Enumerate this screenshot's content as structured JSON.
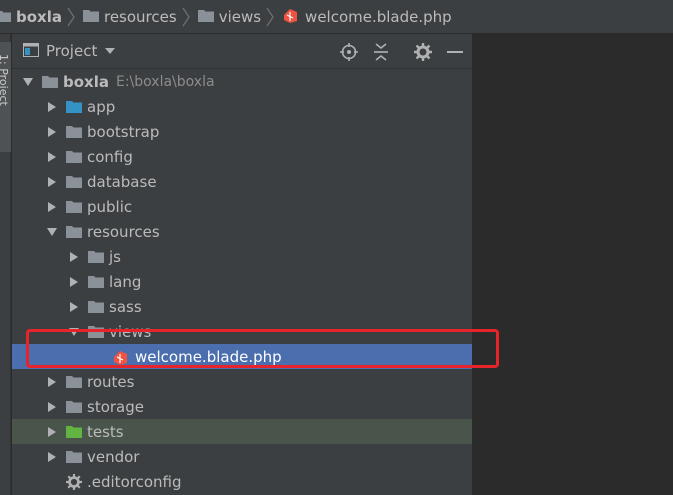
{
  "breadcrumb": {
    "items": [
      {
        "label": "boxla",
        "icon": "folder-icon",
        "bold": true
      },
      {
        "label": "resources",
        "icon": "folder-icon",
        "bold": false
      },
      {
        "label": "views",
        "icon": "folder-icon",
        "bold": false
      },
      {
        "label": "welcome.blade.php",
        "icon": "laravel-blade-icon",
        "bold": false
      }
    ]
  },
  "side_strip": {
    "label": "1: Project"
  },
  "panel": {
    "title": "Project",
    "buttons": [
      "locate-icon",
      "collapse-icon",
      "gear-icon",
      "minimize-icon"
    ]
  },
  "tree": [
    {
      "label": "boxla",
      "extra": "E:\\boxla\\boxla",
      "indent": 0,
      "expanded": true,
      "icon": "folder-icon"
    },
    {
      "label": "app",
      "indent": 1,
      "expanded": false,
      "icon": "folder-blue-icon"
    },
    {
      "label": "bootstrap",
      "indent": 1,
      "expanded": false,
      "icon": "folder-icon"
    },
    {
      "label": "config",
      "indent": 1,
      "expanded": false,
      "icon": "folder-icon"
    },
    {
      "label": "database",
      "indent": 1,
      "expanded": false,
      "icon": "folder-icon"
    },
    {
      "label": "public",
      "indent": 1,
      "expanded": false,
      "icon": "folder-icon"
    },
    {
      "label": "resources",
      "indent": 1,
      "expanded": true,
      "icon": "folder-icon"
    },
    {
      "label": "js",
      "indent": 2,
      "expanded": false,
      "icon": "folder-icon"
    },
    {
      "label": "lang",
      "indent": 2,
      "expanded": false,
      "icon": "folder-icon"
    },
    {
      "label": "sass",
      "indent": 2,
      "expanded": false,
      "icon": "folder-icon"
    },
    {
      "label": "views",
      "indent": 2,
      "expanded": true,
      "icon": "folder-icon"
    },
    {
      "label": "welcome.blade.php",
      "indent": 3,
      "expanded": null,
      "icon": "laravel-blade-icon",
      "selected": true
    },
    {
      "label": "routes",
      "indent": 1,
      "expanded": false,
      "icon": "folder-icon"
    },
    {
      "label": "storage",
      "indent": 1,
      "expanded": false,
      "icon": "folder-icon"
    },
    {
      "label": "tests",
      "indent": 1,
      "expanded": false,
      "icon": "folder-green-icon",
      "highlight": "tests"
    },
    {
      "label": "vendor",
      "indent": 1,
      "expanded": false,
      "icon": "folder-icon"
    },
    {
      "label": ".editorconfig",
      "indent": 1,
      "expanded": null,
      "icon": "gear-file-icon"
    }
  ],
  "colors": {
    "selection": "#4b6eaf",
    "tests_row": "#49544a",
    "annotation_box": "#e8242b",
    "folder": "#8a9199",
    "folder_blue": "#3592c4",
    "folder_green": "#62b543",
    "blade": "#f05340"
  }
}
